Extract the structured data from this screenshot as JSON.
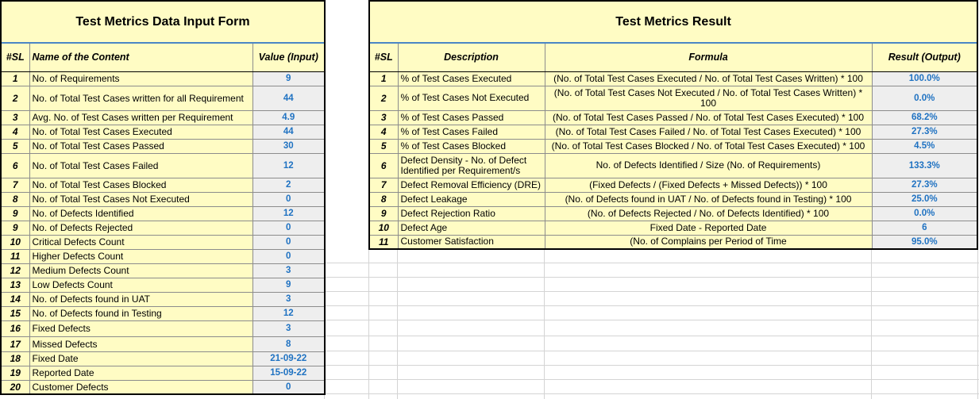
{
  "input_form": {
    "title": "Test Metrics Data Input Form",
    "headers": {
      "sl": "#SL",
      "name": "Name of the Content",
      "value": "Value (Input)"
    },
    "rows": [
      {
        "sl": "1",
        "name": "No. of Requirements",
        "value": "9"
      },
      {
        "sl": "2",
        "name": "No. of Total Test Cases written for all Requirement",
        "value": "44"
      },
      {
        "sl": "3",
        "name": "Avg. No. of Test Cases written per Requirement",
        "value": "4.9"
      },
      {
        "sl": "4",
        "name": "No. of Total Test Cases Executed",
        "value": "44"
      },
      {
        "sl": "5",
        "name": "No. of Total Test Cases Passed",
        "value": "30"
      },
      {
        "sl": "6",
        "name": "No. of Total Test Cases Failed",
        "value": "12"
      },
      {
        "sl": "7",
        "name": "No. of Total Test Cases Blocked",
        "value": "2"
      },
      {
        "sl": "8",
        "name": "No. of Total Test Cases Not Executed",
        "value": "0"
      },
      {
        "sl": "9",
        "name": "No. of Defects Identified",
        "value": "12"
      },
      {
        "sl": "9",
        "name": "No. of Defects Rejected",
        "value": "0"
      },
      {
        "sl": "10",
        "name": "Critical Defects Count",
        "value": "0"
      },
      {
        "sl": "11",
        "name": "Higher Defects Count",
        "value": "0"
      },
      {
        "sl": "12",
        "name": "Medium Defects Count",
        "value": "3"
      },
      {
        "sl": "13",
        "name": "Low Defects Count",
        "value": "9"
      },
      {
        "sl": "14",
        "name": "No. of Defects found in UAT",
        "value": "3"
      },
      {
        "sl": "15",
        "name": "No. of Defects found in Testing",
        "value": "12"
      },
      {
        "sl": "16",
        "name": "Fixed Defects",
        "value": "3"
      },
      {
        "sl": "17",
        "name": "Missed Defects",
        "value": "8"
      },
      {
        "sl": "18",
        "name": "Fixed Date",
        "value": "21-09-22"
      },
      {
        "sl": "19",
        "name": "Reported Date",
        "value": "15-09-22"
      },
      {
        "sl": "20",
        "name": "Customer Defects",
        "value": "0"
      }
    ]
  },
  "result": {
    "title": "Test Metrics Result",
    "headers": {
      "sl": "#SL",
      "description": "Description",
      "formula": "Formula",
      "result": "Result (Output)"
    },
    "rows": [
      {
        "sl": "1",
        "description": "% of Test Cases Executed",
        "formula": "(No. of Total Test Cases Executed / No. of Total Test Cases Written) * 100",
        "result": "100.0%"
      },
      {
        "sl": "2",
        "description": "% of Test Cases Not Executed",
        "formula": "(No. of Total Test Cases Not Executed / No. of Total Test Cases Written) * 100",
        "result": "0.0%"
      },
      {
        "sl": "3",
        "description": "% of Test Cases Passed",
        "formula": "(No. of Total Test Cases Passed / No. of Total Test Cases Executed) * 100",
        "result": "68.2%"
      },
      {
        "sl": "4",
        "description": "% of Test Cases Failed",
        "formula": "(No. of Total Test Cases Failed / No. of Total Test Cases Executed) * 100",
        "result": "27.3%"
      },
      {
        "sl": "5",
        "description": "% of Test Cases Blocked",
        "formula": "(No. of Total Test Cases Blocked / No. of Total Test Cases Executed) * 100",
        "result": "4.5%"
      },
      {
        "sl": "6",
        "description": "Defect Density - No. of Defect Identified per Requirement/s",
        "formula": "No. of Defects Identified / Size (No. of Requirements)",
        "result": "133.3%"
      },
      {
        "sl": "7",
        "description": "Defect Removal Efficiency (DRE)",
        "formula": "(Fixed Defects / (Fixed Defects + Missed Defects)) * 100",
        "result": "27.3%"
      },
      {
        "sl": "8",
        "description": "Defect Leakage",
        "formula": "(No. of Defects found in UAT / No. of Defects found in Testing) * 100",
        "result": "25.0%"
      },
      {
        "sl": "9",
        "description": "Defect Rejection Ratio",
        "formula": "(No. of Defects Rejected / No. of Defects Identified) * 100",
        "result": "0.0%"
      },
      {
        "sl": "10",
        "description": "Defect Age",
        "formula": "Fixed Date - Reported Date",
        "result": "6"
      },
      {
        "sl": "11",
        "description": "Customer Satisfaction",
        "formula": "(No. of Complains per Period of Time",
        "result": "95.0%"
      }
    ]
  }
}
